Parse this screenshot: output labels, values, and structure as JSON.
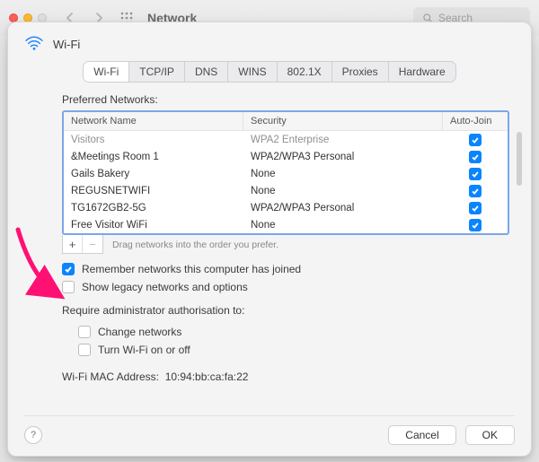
{
  "toolbar": {
    "title": "Network",
    "search_placeholder": "Search"
  },
  "sheet": {
    "title": "Wi-Fi",
    "tabs": [
      "Wi-Fi",
      "TCP/IP",
      "DNS",
      "WINS",
      "802.1X",
      "Proxies",
      "Hardware"
    ],
    "active_tab": 0,
    "preferred_networks_label": "Preferred Networks:",
    "columns": {
      "name": "Network Name",
      "security": "Security",
      "auto_join": "Auto-Join"
    },
    "networks": [
      {
        "name": "Visitors",
        "security": "WPA2 Enterprise",
        "auto_join": true
      },
      {
        "name": "&Meetings Room 1",
        "security": "WPA2/WPA3 Personal",
        "auto_join": true
      },
      {
        "name": "Gails Bakery",
        "security": "None",
        "auto_join": true
      },
      {
        "name": "REGUSNETWIFI",
        "security": "None",
        "auto_join": true
      },
      {
        "name": "TG1672GB2-5G",
        "security": "WPA2/WPA3 Personal",
        "auto_join": true
      },
      {
        "name": "Free Visitor WiFi",
        "security": "None",
        "auto_join": true
      }
    ],
    "drag_hint": "Drag networks into the order you prefer.",
    "options": {
      "remember_label": "Remember networks this computer has joined",
      "remember_checked": true,
      "legacy_label": "Show legacy networks and options",
      "legacy_checked": false,
      "admin_title": "Require administrator authorisation to:",
      "change_networks_label": "Change networks",
      "change_networks_checked": false,
      "turn_wifi_label": "Turn Wi-Fi on or off",
      "turn_wifi_checked": false
    },
    "mac": {
      "label": "Wi-Fi MAC Address:",
      "value": "10:94:bb:ca:fa:22"
    },
    "buttons": {
      "cancel": "Cancel",
      "ok": "OK",
      "help": "?"
    },
    "icons": {
      "add": "+",
      "remove": "−"
    }
  }
}
